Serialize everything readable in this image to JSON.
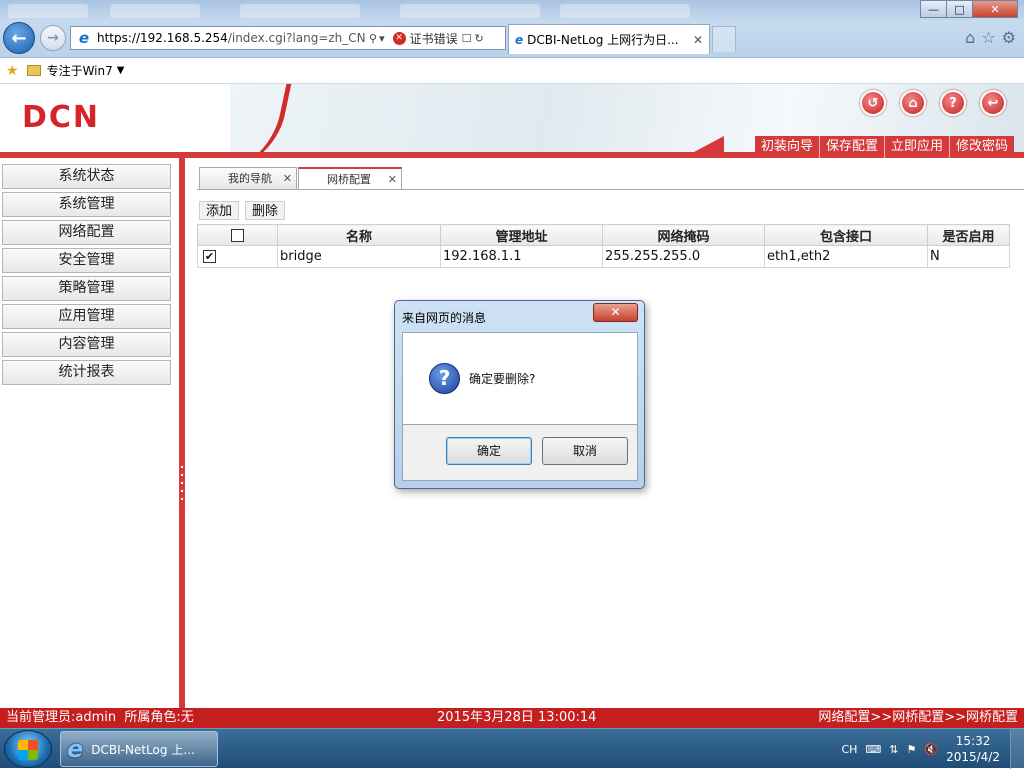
{
  "browser": {
    "url_host": "https://192.168.5.254",
    "url_path": "/index.cgi?lang=zh_CN.U",
    "cert_error": "证书错误",
    "active_tab_title": "DCBI-NetLog 上网行为日...",
    "tab_close": "✕",
    "favorites_item": "专注于Win7"
  },
  "header": {
    "logo": "DCN",
    "menu": [
      "初装向导",
      "保存配置",
      "立即应用",
      "修改密码"
    ]
  },
  "sidebar": {
    "items": [
      "系统状态",
      "系统管理",
      "网络配置",
      "安全管理",
      "策略管理",
      "应用管理",
      "内容管理",
      "统计报表"
    ]
  },
  "content_tabs": [
    {
      "label": "我的导航",
      "close": "✕"
    },
    {
      "label": "网桥配置",
      "close": "✕"
    }
  ],
  "toolbar": {
    "add_label": "添加",
    "delete_label": "删除"
  },
  "table": {
    "columns": [
      "",
      "名称",
      "管理地址",
      "网络掩码",
      "包含接口",
      "是否启用"
    ],
    "rows": [
      {
        "checked": "✔",
        "name": "bridge",
        "address": "192.168.1.1",
        "mask": "255.255.255.0",
        "interfaces": "eth1,eth2",
        "enabled": "N"
      }
    ]
  },
  "dialog": {
    "title": "来自网页的消息",
    "close_glyph": "✕",
    "message": "确定要删除?",
    "ok_label": "确定",
    "cancel_label": "取消"
  },
  "statusbar": {
    "user": "当前管理员:admin  所属角色:无",
    "time": "2015年3月28日 13:00:14",
    "path": "网络配置>>网桥配置>>网桥配置"
  },
  "taskbar": {
    "ie_task_label": "DCBI-NetLog 上...",
    "lang": "CH",
    "clock_time": "15:32",
    "clock_date": "2015/4/2"
  },
  "colors": {
    "accent_red": "#d43a3a",
    "status_red": "#c41e1e",
    "logo_red": "#d8232a"
  },
  "icons": [
    "back-arrow-icon",
    "forward-arrow-icon",
    "ie-icon",
    "search-icon",
    "cert-error-icon",
    "lock-icon",
    "refresh-icon",
    "home-icon",
    "star-icon",
    "gear-icon",
    "favorites-star-icon",
    "folder-icon",
    "logout-icon",
    "help-icon",
    "exit-icon",
    "question-icon",
    "windows-start-icon",
    "keyboard-icon",
    "network-icon",
    "flag-icon",
    "volume-muted-icon"
  ]
}
